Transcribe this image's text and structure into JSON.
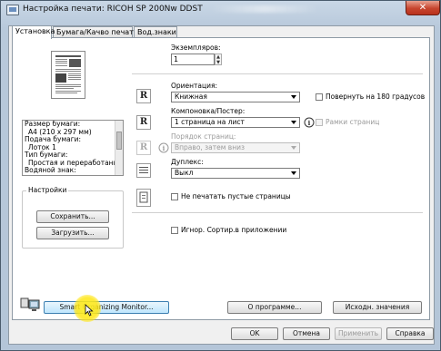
{
  "window": {
    "title": "Настройка печати: RICOH SP 200Nw DDST",
    "close_label": "✕"
  },
  "tabs": [
    {
      "label": "Установка",
      "active": true
    },
    {
      "label": "Бумага/Качво печати",
      "active": false
    },
    {
      "label": "Вод.знаки",
      "active": false
    }
  ],
  "copies": {
    "label": "Экземпляров:",
    "value": "1"
  },
  "orientation": {
    "label": "Ориентация:",
    "value": "Книжная",
    "rotate_label": "Повернуть на 180 градусов"
  },
  "layout": {
    "label": "Компоновка/Постер:",
    "value": "1 страница на лист",
    "border_label": "Рамки страниц"
  },
  "page_order": {
    "label": "Порядок страниц:",
    "value": "Вправо, затем вниз"
  },
  "duplex": {
    "label": "Дуплекс:",
    "value": "Выкл"
  },
  "blank_pages": {
    "label": "Не печатать пустые страницы"
  },
  "ignore_sort": {
    "label": "Игнор. Сортир.в приложении"
  },
  "summary_list": [
    "Размер бумаги:",
    "  A4 (210 x 297 мм)",
    "Подача бумаги:",
    "  Лоток 1",
    "Тип бумаги:",
    "  Простая и переработанна",
    "Водяной знак:"
  ],
  "settings_group": {
    "label": "Настройки",
    "save_label": "Сохранить...",
    "load_label": "Загрузить..."
  },
  "bottom_buttons": {
    "monitor_label": "Smart Organizing Monitor...",
    "about_label": "О программе...",
    "defaults_label": "Исходн. значения"
  },
  "dialog_buttons": {
    "ok_label": "OK",
    "cancel_label": "Отмена",
    "apply_label": "Применить",
    "help_label": "Справка"
  },
  "icons": {
    "orientation": "R",
    "layout": "R",
    "page_order": "R"
  }
}
